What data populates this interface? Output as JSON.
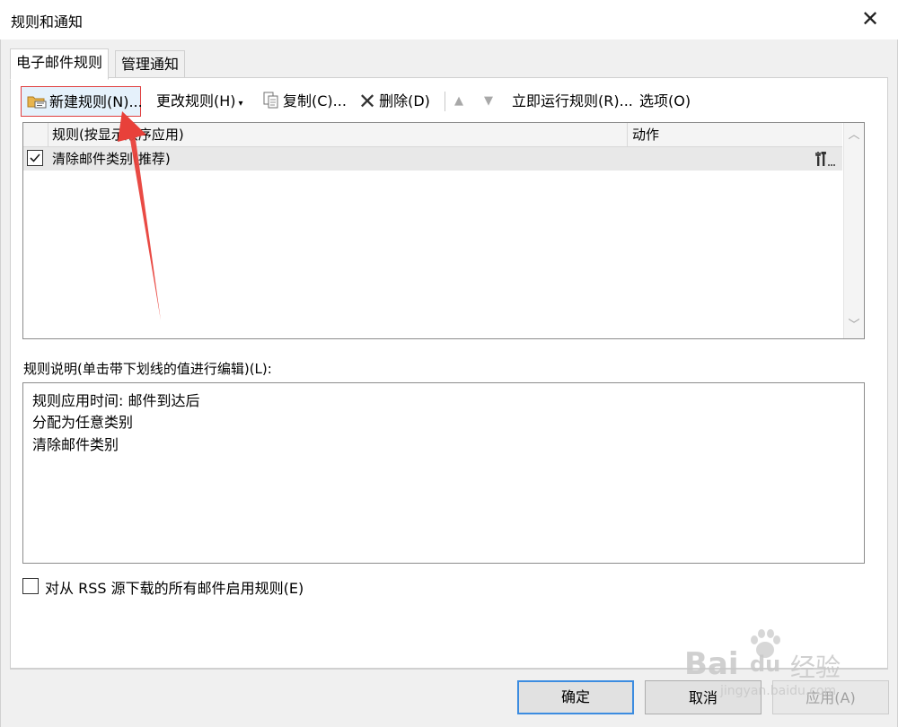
{
  "window": {
    "title": "规则和通知",
    "close_glyph": "✕"
  },
  "tabs": [
    {
      "label": "电子邮件规则",
      "active": true
    },
    {
      "label": "管理通知",
      "active": false
    }
  ],
  "toolbar": {
    "new_rule": "新建规则(N)...",
    "change_rule": "更改规则(H)",
    "copy": "复制(C)...",
    "delete": "删除(D)",
    "move_up_glyph": "▲",
    "move_down_glyph": "▼",
    "run_now": "立即运行规则(R)...",
    "options": "选项(O)"
  },
  "rules_grid": {
    "columns": [
      "规则(按显示顺序应用)",
      "动作"
    ],
    "rows": [
      {
        "name": "清除邮件类别(推荐)",
        "checked": true,
        "action_icon": "settings-tools-icon"
      }
    ]
  },
  "description": {
    "label": "规则说明(单击带下划线的值进行编辑)(L):",
    "lines": [
      "规则应用时间: 邮件到达后",
      "分配为任意类别",
      "清除邮件类别"
    ]
  },
  "rss_checkbox": {
    "label": "对从 RSS 源下载的所有邮件启用规则(E)",
    "checked": false
  },
  "buttons": {
    "ok": "确定",
    "cancel": "取消",
    "apply": "应用(A)"
  },
  "watermark": {
    "brand": "Bai",
    "brand2": "du",
    "cn": "经验",
    "url": "jingyan.baidu.com"
  },
  "colors": {
    "highlight_border": "#e04040",
    "arrow": "#e8403a",
    "ok_border": "#3c8ce0"
  }
}
